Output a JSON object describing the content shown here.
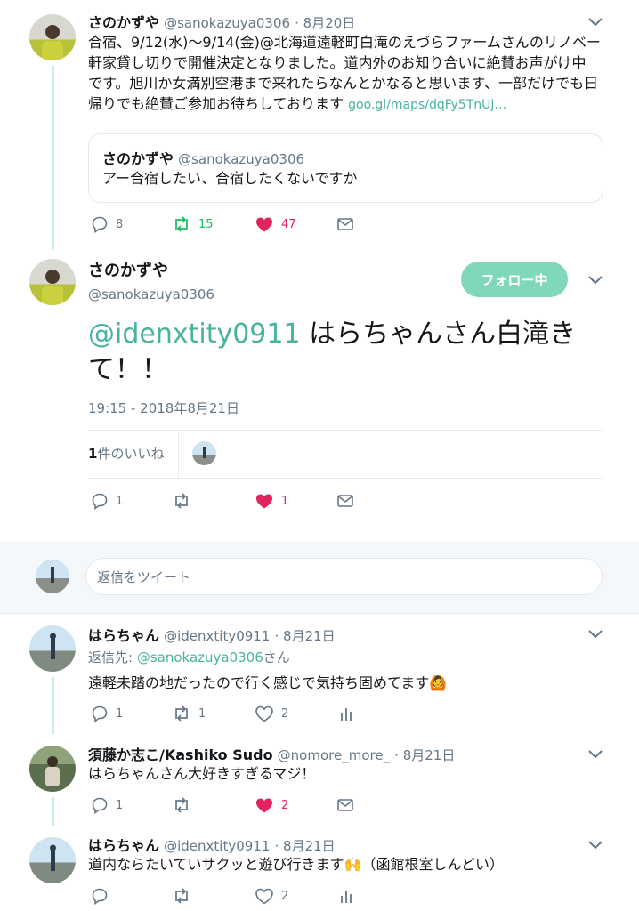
{
  "colors": {
    "accent": "#4ab3a0",
    "follow_bg": "#7fd8b8",
    "like": "#e0245e",
    "retweet": "#17bf63",
    "thread_line": "#c6ede0"
  },
  "tweet1": {
    "name": "さのかずや",
    "handle": "@sanokazuya0306",
    "time": "· 8月20日",
    "lines": [
      "合宿、9/12(水)〜9/14(金)@北海道遠軽町白滝のえづらファームさんのリノベー",
      "軒家貸し切りで開催決定となりました。道内外のお知り合いに絶賛お声がけ中",
      "です。旭川か女満別空港まで来れたらなんとかなると思います、一部だけでも日",
      "帰りでも絶賛ご参加お待ちしております"
    ],
    "link": "goo.gl/maps/dqFy5TnUj…",
    "quote": {
      "name": "さのかずや",
      "handle": "@sanokazuya0306",
      "text": "アー合宿したい、合宿したくないですか"
    },
    "reply_count": "8",
    "retweet_count": "15",
    "like_count": "47"
  },
  "main": {
    "name": "さのかずや",
    "handle": "@sanokazuya0306",
    "follow_label": "フォロー中",
    "mention": "@idenxtity0911",
    "text_line1": " はらちゃんさん白滝き",
    "text_line2": "て！！",
    "timestamp": "19:15 - 2018年8月21日",
    "likes_count": "1",
    "likes_label": "件のいいね",
    "reply_count": "1",
    "like_count": "1"
  },
  "reply_box": {
    "placeholder": "返信をツイート"
  },
  "replies": [
    {
      "name": "はらちゃん",
      "handle": "@idenxtity0911",
      "time": "· 8月21日",
      "reply_to_prefix": "返信先: ",
      "reply_to_handle": "@sanokazuya0306",
      "reply_to_suffix": "さん",
      "text": "遠軽未踏の地だったので行く感じで気持ち固めてます🙆",
      "reply_count": "1",
      "retweet_count": "1",
      "like_count": "2"
    },
    {
      "name": "須藤か志こ/Kashiko Sudo",
      "handle": "@nomore_more_",
      "time": "· 8月21日",
      "text": "はらちゃんさん大好きすぎるマジ！",
      "reply_count": "1",
      "like_count": "2"
    },
    {
      "name": "はらちゃん",
      "handle": "@idenxtity0911",
      "time": "· 8月21日",
      "text": "道内ならたいていサクッと遊び行きます🙌（函館根室しんどい）",
      "like_count": "2"
    }
  ],
  "icons": [
    "chevron-down-icon",
    "reply-icon",
    "retweet-icon",
    "like-icon",
    "message-icon",
    "analytics-icon"
  ]
}
